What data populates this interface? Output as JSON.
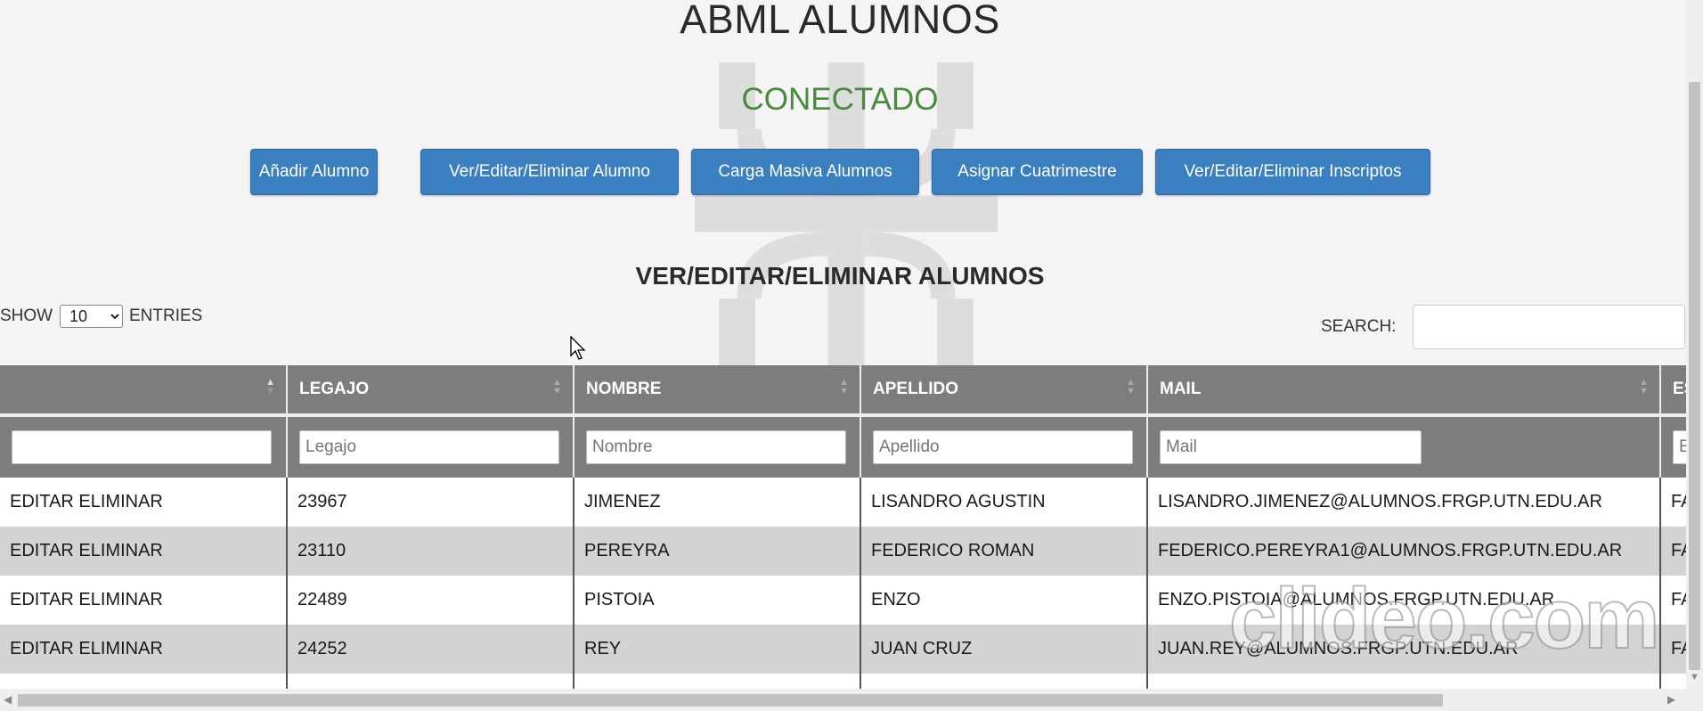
{
  "header": {
    "title": "ABML ALUMNOS",
    "status": "CONECTADO",
    "status_color": "#4a8a3e"
  },
  "actions": [
    {
      "label": "Añadir Alumno"
    },
    {
      "label": "Ver/Editar/Eliminar Alumno"
    },
    {
      "label": "Carga Masiva Alumnos"
    },
    {
      "label": "Asignar Cuatrimestre"
    },
    {
      "label": "Ver/Editar/Eliminar Inscriptos"
    }
  ],
  "section": {
    "heading": "VER/EDITAR/ELIMINAR ALUMNOS"
  },
  "length_control": {
    "show_label": "SHOW",
    "selected": "10",
    "entries_label": "ENTRIES"
  },
  "search": {
    "label": "SEARCH:",
    "value": ""
  },
  "table": {
    "columns": [
      "",
      "LEGAJO",
      "NOMBRE",
      "APELLIDO",
      "MAIL",
      "ES"
    ],
    "filter_placeholders": [
      "",
      "Legajo",
      "Nombre",
      "Apellido",
      "Mail",
      "E"
    ],
    "rows": [
      {
        "actions": "EDITAR ELIMINAR",
        "legajo": "23967",
        "nombre": "JIMENEZ",
        "apellido": "LISANDRO AGUSTIN",
        "mail": "LISANDRO.JIMENEZ@ALUMNOS.FRGP.UTN.EDU.AR",
        "extra": "FA"
      },
      {
        "actions": "EDITAR ELIMINAR",
        "legajo": "23110",
        "nombre": "PEREYRA",
        "apellido": "FEDERICO ROMAN",
        "mail": "FEDERICO.PEREYRA1@ALUMNOS.FRGP.UTN.EDU.AR",
        "extra": "FA"
      },
      {
        "actions": "EDITAR ELIMINAR",
        "legajo": "22489",
        "nombre": "PISTOIA",
        "apellido": "ENZO",
        "mail": "ENZO.PISTOIA@ALUMNOS.FRGP.UTN.EDU.AR",
        "extra": "FA"
      },
      {
        "actions": "EDITAR ELIMINAR",
        "legajo": "24252",
        "nombre": "REY",
        "apellido": "JUAN CRUZ",
        "mail": "JUAN.REY@ALUMNOS.FRGP.UTN.EDU.AR",
        "extra": "FA"
      }
    ]
  },
  "watermark": {
    "text": "clideo.com"
  },
  "colors": {
    "button_bg": "#3a7fc0",
    "table_header_bg": "#7d7d7d",
    "row_alt_bg": "#d3d3d3"
  }
}
